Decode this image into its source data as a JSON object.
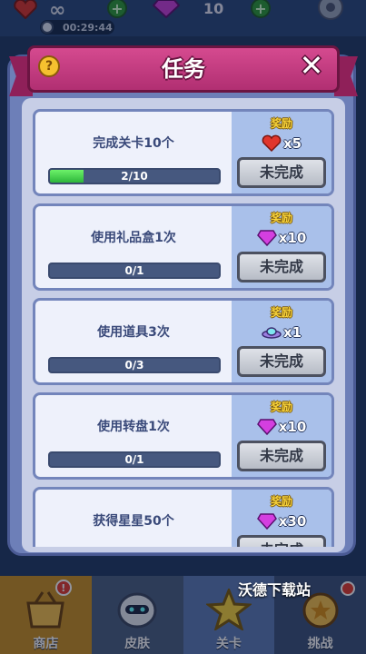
{
  "hud": {
    "infinity": "∞",
    "gem_count": "10",
    "timer": "00:29:44"
  },
  "modal": {
    "title": "任务",
    "help": "?",
    "close": "✕"
  },
  "reward_label": "奖励",
  "tasks": [
    {
      "name": "完成关卡10个",
      "progress_text": "2/10",
      "progress": 0.2,
      "reward_icon": "heart-icon",
      "reward_amount": "x5",
      "status": "未完成"
    },
    {
      "name": "使用礼品盒1次",
      "progress_text": "0/1",
      "progress": 0,
      "reward_icon": "gem-icon",
      "reward_amount": "x10",
      "status": "未完成"
    },
    {
      "name": "使用道具3次",
      "progress_text": "0/3",
      "progress": 0,
      "reward_icon": "ufo-icon",
      "reward_amount": "x1",
      "status": "未完成"
    },
    {
      "name": "使用转盘1次",
      "progress_text": "0/1",
      "progress": 0,
      "reward_icon": "gem-icon",
      "reward_amount": "x10",
      "status": "未完成"
    },
    {
      "name": "获得星星50个",
      "progress_text": "",
      "progress": 0,
      "reward_icon": "gem-icon",
      "reward_amount": "x30",
      "status": "未完成"
    }
  ],
  "nav": {
    "shop": "商店",
    "skin": "皮肤",
    "level": "关卡",
    "fight": "挑战",
    "badge": "!"
  },
  "watermark": "沃德下载站",
  "colors": {
    "modal_bg": "#6d7fb8",
    "ribbon": "#c23f80",
    "progress_fill": "#3ccf45",
    "reward_panel": "#a9c0ea"
  }
}
